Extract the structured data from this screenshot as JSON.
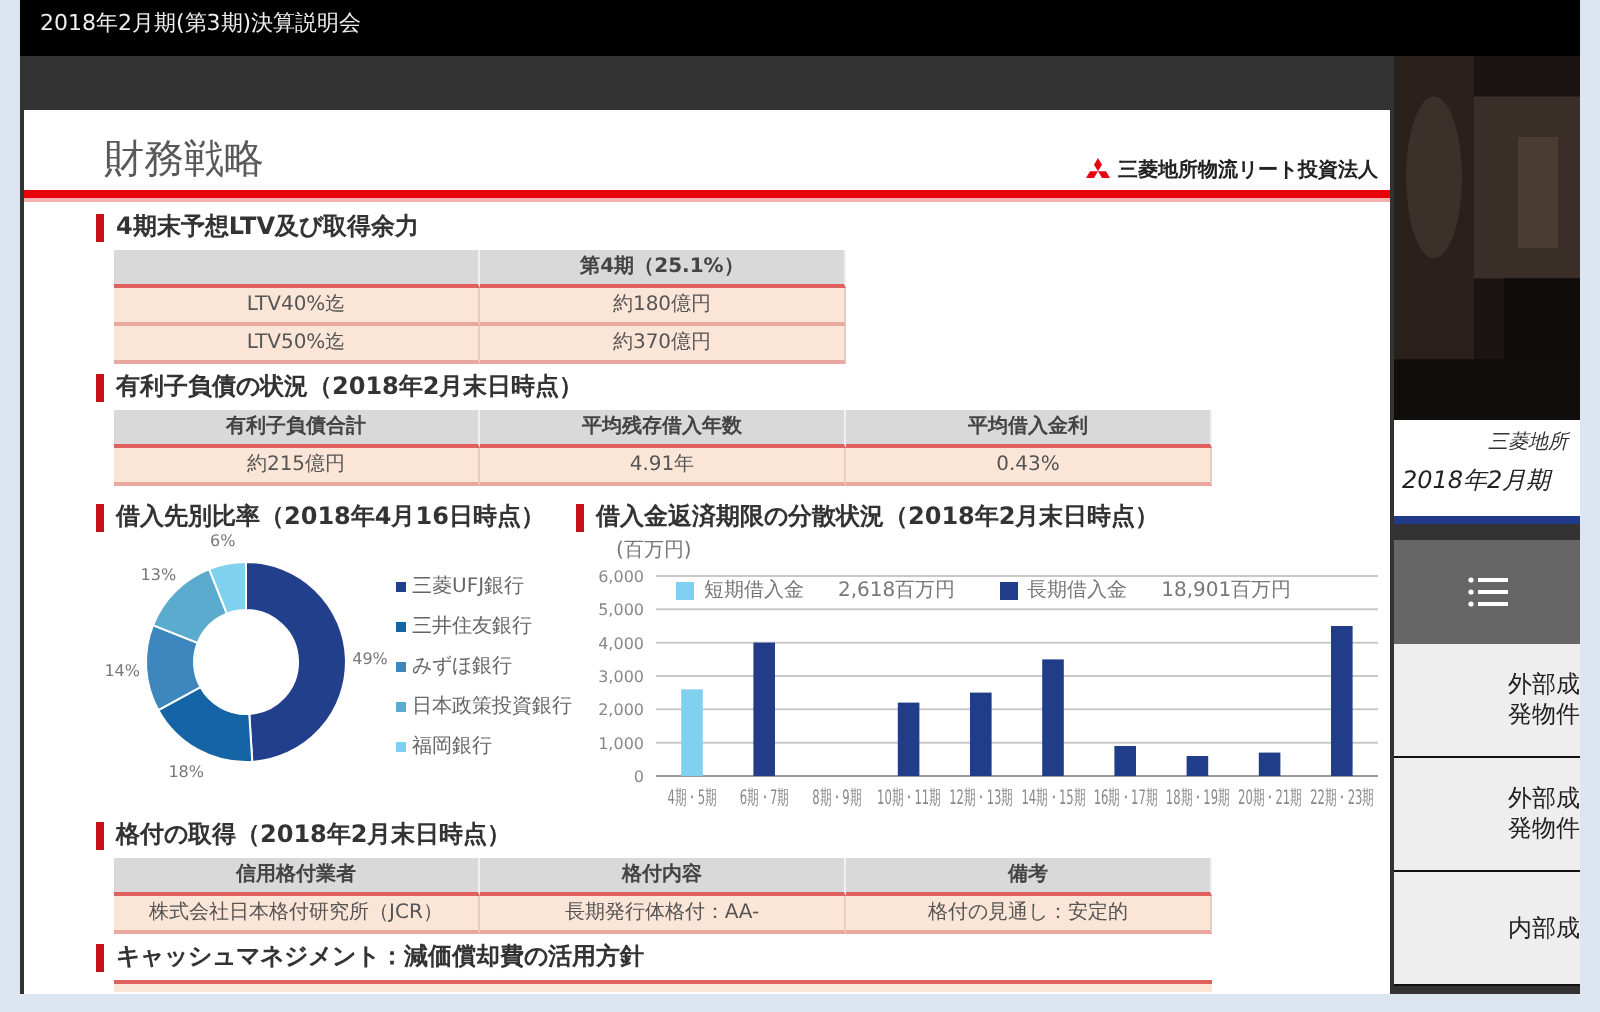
{
  "window": {
    "title": "2018年2月期(第3期)決算説明会"
  },
  "slide": {
    "title": "財務戦略",
    "brand": "三菱地所物流リート投資法人",
    "sections": [
      {
        "kind": "table",
        "heading": "4期末予想LTV及び取得余力",
        "columns": [
          "",
          "第4期（25.1%）"
        ],
        "rows": [
          [
            "LTV40%迄",
            "約180億円"
          ],
          [
            "LTV50%迄",
            "約370億円"
          ]
        ]
      },
      {
        "kind": "table",
        "heading": "有利子負債の状況（2018年2月末日時点）",
        "columns": [
          "有利子負債合計",
          "平均残存借入年数",
          "平均借入金利"
        ],
        "rows": [
          [
            "約215億円",
            "4.91年",
            "0.43%"
          ]
        ]
      },
      {
        "kind": "charts",
        "panels": [
          {
            "heading": "借入先別比率（2018年4月16日時点）",
            "chart_data": {
              "type": "donut",
              "categories": [
                "三菱UFJ銀行",
                "三井住友銀行",
                "みずほ銀行",
                "日本政策投資銀行",
                "福岡銀行"
              ],
              "colors": [
                "#213f8b",
                "#1565a6",
                "#3d86be",
                "#5aabcd",
                "#7fd1ef"
              ],
              "values": [
                49,
                18,
                14,
                13,
                6
              ],
              "value_labels": [
                "49%",
                "18%",
                "14%",
                "13%",
                "6%"
              ]
            }
          },
          {
            "heading": "借入金返済期限の分散状況（2018年2月末日時点）",
            "totals": [
              "2,618百万円",
              "18,901百万円"
            ],
            "chart_data": {
              "type": "bar",
              "ylabel": "(百万円)",
              "grid": true,
              "legend": true,
              "categories": [
                "4期・5期",
                "6期・7期",
                "8期・9期",
                "10期・11期",
                "12期・13期",
                "14期・15期",
                "16期・17期",
                "18期・19期",
                "20期・21期",
                "22期・23期"
              ],
              "series": [
                {
                  "name": "短期借入金",
                  "color": "#7fd1ef",
                  "values": [
                    2600,
                    null,
                    null,
                    null,
                    null,
                    null,
                    null,
                    null,
                    null,
                    null
                  ]
                },
                {
                  "name": "長期借入金",
                  "color": "#213d8a",
                  "values": [
                    null,
                    4000,
                    null,
                    2200,
                    2500,
                    3500,
                    900,
                    600,
                    700,
                    4500
                  ]
                }
              ],
              "ylim": [
                0,
                6000
              ],
              "yticks": [
                {
                  "value": 0,
                  "label": "0"
                },
                {
                  "value": 1000,
                  "label": "1,000"
                },
                {
                  "value": 2000,
                  "label": "2,000"
                },
                {
                  "value": 3000,
                  "label": "3,000"
                },
                {
                  "value": 4000,
                  "label": "4,000"
                },
                {
                  "value": 5000,
                  "label": "5,000"
                },
                {
                  "value": 6000,
                  "label": "6,000"
                }
              ]
            }
          }
        ]
      },
      {
        "kind": "table",
        "heading": "格付の取得（2018年2月末日時点）",
        "columns": [
          "信用格付業者",
          "格付内容",
          "備考"
        ],
        "rows": [
          [
            "株式会社日本格付研究所（JCR）",
            "長期発行体格付：AA-",
            "格付の見通し：安定的"
          ]
        ]
      },
      {
        "kind": "cut_table",
        "heading": "キャッシュマネジメント：減価償却費の活用方針"
      }
    ]
  },
  "side_panel": {
    "banner": {
      "line_1": "三菱地所",
      "line_2": "2018年2月期"
    },
    "items": [
      {
        "lines": [
          "外部成",
          "発物件"
        ]
      },
      {
        "lines": [
          "外部成",
          "発物件"
        ]
      },
      {
        "lines": [
          "内部成"
        ]
      }
    ]
  }
}
